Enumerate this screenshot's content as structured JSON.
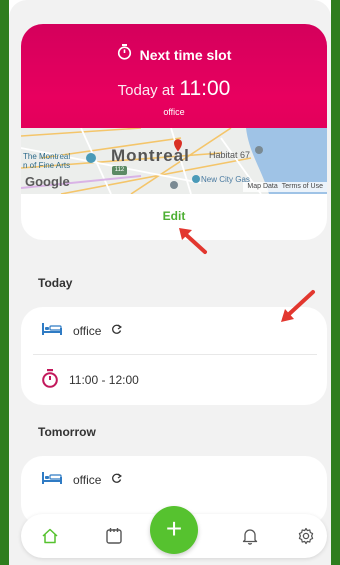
{
  "next_slot": {
    "title": "Next time slot",
    "when_prefix": "Today at",
    "when_time": "11:00",
    "place": "office",
    "edit_label": "Edit"
  },
  "map": {
    "city_label": "Montreal",
    "museum_label_line1": "The Montreal",
    "museum_label_line2": "n of Fine Arts",
    "habitat_label": "Habitat 67",
    "newcity_label": "New City Gas",
    "road_badge": "112",
    "google_label": "Google",
    "map_data": "Map Data",
    "terms": "Terms of Use"
  },
  "sections": [
    {
      "heading": "Today",
      "location": "office",
      "time_range": "11:00 - 12:00"
    },
    {
      "heading": "Tomorrow",
      "location": "office"
    }
  ],
  "colors": {
    "accent_green": "#56c22f",
    "header_pink": "#e0005d",
    "icon_blue": "#2f7bc4",
    "icon_magenta": "#c2185b",
    "annotation_red": "#e2372f"
  },
  "icons": {
    "title_icon": "stopwatch-icon",
    "location_icon": "bed-icon",
    "sync_icon": "sync-icon",
    "time_icon": "stopwatch-icon",
    "nav": [
      "home-icon",
      "calendar-icon",
      "plus-icon",
      "bell-icon",
      "gear-icon"
    ]
  }
}
